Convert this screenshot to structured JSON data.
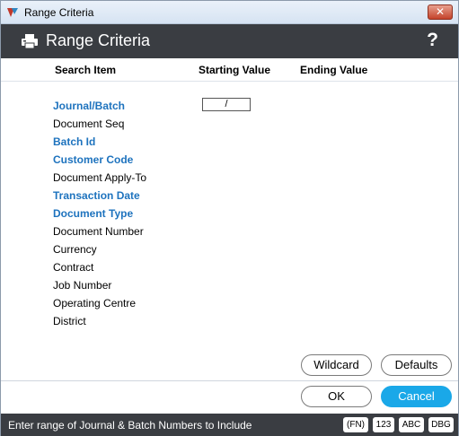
{
  "window": {
    "title": "Range Criteria"
  },
  "header": {
    "title": "Range Criteria",
    "help": "?"
  },
  "columns": {
    "search_item": "Search Item",
    "starting_value": "Starting Value",
    "ending_value": "Ending Value"
  },
  "items": [
    {
      "label": "Journal/Batch",
      "required": true
    },
    {
      "label": "Document Seq",
      "required": false
    },
    {
      "label": "Batch Id",
      "required": true
    },
    {
      "label": "Customer Code",
      "required": true
    },
    {
      "label": "Document Apply-To",
      "required": false
    },
    {
      "label": "Transaction Date",
      "required": true
    },
    {
      "label": "Document Type",
      "required": true
    },
    {
      "label": "Document Number",
      "required": false
    },
    {
      "label": "Currency",
      "required": false
    },
    {
      "label": "Contract",
      "required": false
    },
    {
      "label": "Job Number",
      "required": false
    },
    {
      "label": "Operating Centre",
      "required": false
    },
    {
      "label": "District",
      "required": false
    }
  ],
  "journal_batch_start": "/",
  "buttons": {
    "wildcard": "Wildcard",
    "defaults": "Defaults",
    "ok": "OK",
    "cancel": "Cancel"
  },
  "status": {
    "text": "Enter range of Journal & Batch Numbers to Include",
    "badges": [
      "(FN)",
      "123",
      "ABC",
      "DBG"
    ]
  },
  "colors": {
    "accent": "#1aa8e8",
    "required_label": "#1e73be",
    "header_bg": "#3a3d42"
  }
}
